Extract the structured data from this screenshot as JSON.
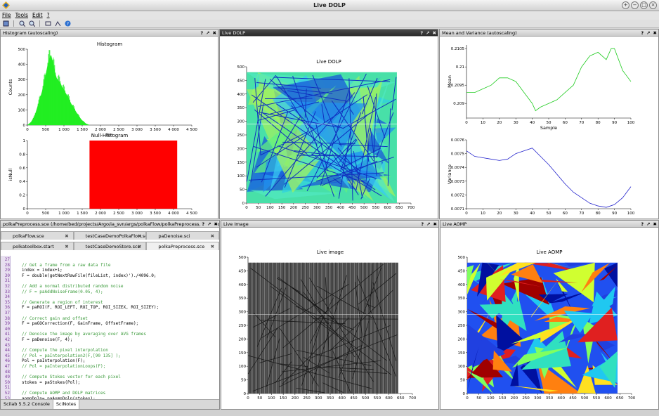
{
  "window": {
    "title": "Live DOLP"
  },
  "menu": [
    {
      "label": "File"
    },
    {
      "label": "Tools"
    },
    {
      "label": "Edit"
    },
    {
      "label": "?"
    }
  ],
  "toolbar_icons": [
    "new-window-icon",
    "zoom-in-icon",
    "zoom-out-icon",
    "rotate-icon",
    "datatip-icon",
    "help-icon"
  ],
  "panels": {
    "histogram": {
      "header": "Histogram (autoscaling)"
    },
    "dolp": {
      "header": "Live DOLP"
    },
    "meanvar": {
      "header": "Mean and Variance (autoscaling)"
    },
    "scinotes": {
      "header": "polkaPreprocess.sce (/home/bed/projects/Argo/ia_svn/args/polkaFlow/polkaPreprocess.sce) - SciNotes"
    },
    "image": {
      "header": "Live Image"
    },
    "aomp": {
      "header": "Live AOMP"
    }
  },
  "panel_buttons": [
    "?",
    "↗",
    "✖"
  ],
  "chart_data": [
    {
      "type": "bar",
      "title": "Histogram",
      "xlabel": "Bin",
      "ylabel": "Counts",
      "xlim": [
        0,
        4500
      ],
      "ylim": [
        0,
        500
      ],
      "xticks": [
        "0",
        "500",
        "1 000",
        "1 500",
        "2 000",
        "2 500",
        "3 000",
        "3 500",
        "4 000",
        "4 500"
      ],
      "yticks": [
        "0",
        "100",
        "200",
        "300",
        "400",
        "500"
      ],
      "x": [
        0,
        100,
        200,
        300,
        400,
        500,
        550,
        600,
        650,
        700,
        750,
        800,
        850,
        900,
        950,
        1000,
        1100,
        1200,
        1300,
        1400,
        1500,
        1600,
        1700
      ],
      "values": [
        0,
        20,
        60,
        140,
        220,
        330,
        390,
        440,
        460,
        410,
        350,
        310,
        290,
        280,
        250,
        230,
        190,
        140,
        100,
        60,
        30,
        10,
        0
      ],
      "color": "#22ee22"
    },
    {
      "type": "bar",
      "title": "Null-Histogram",
      "xlabel": "",
      "ylabel": "isNull",
      "xlim": [
        0,
        4500
      ],
      "ylim": [
        0,
        1
      ],
      "xticks": [
        "0",
        "500",
        "1 000",
        "1 500",
        "2 000",
        "2 500",
        "3 000",
        "3 500",
        "4 000",
        "4 500"
      ],
      "yticks": [
        "0",
        "0.2",
        "0.4",
        "0.6",
        "0.8",
        "1"
      ],
      "bar": {
        "x0": 1700,
        "x1": 4100,
        "value": 1
      },
      "color": "#ff0000"
    },
    {
      "type": "heatmap",
      "title": "Live DOLP",
      "xlim": [
        0,
        700
      ],
      "ylim": [
        0,
        500
      ],
      "xticks": [
        "0",
        "50",
        "100",
        "150",
        "200",
        "250",
        "300",
        "350",
        "400",
        "450",
        "500",
        "550",
        "600",
        "650",
        "700"
      ],
      "yticks": [
        "0",
        "50",
        "100",
        "150",
        "200",
        "250",
        "300",
        "350",
        "400",
        "450",
        "500"
      ]
    },
    {
      "type": "line",
      "xlabel": "Sample",
      "ylabel": "Mean",
      "xlim": [
        0,
        100
      ],
      "ylim": [
        0.2086,
        0.2106
      ],
      "xticks": [
        "0",
        "10",
        "20",
        "30",
        "40",
        "50",
        "60",
        "70",
        "80",
        "90",
        "100"
      ],
      "yticks": [
        "0.209",
        "0.2095",
        "0.21",
        "0.2105"
      ],
      "series": [
        {
          "x": [
            0,
            5,
            10,
            15,
            20,
            25,
            30,
            35,
            40,
            42,
            45,
            50,
            55,
            60,
            65,
            70,
            75,
            80,
            85,
            88,
            90,
            95,
            100
          ],
          "values": [
            0.2093,
            0.2093,
            0.2094,
            0.2095,
            0.2097,
            0.2097,
            0.2096,
            0.2093,
            0.209,
            0.2088,
            0.2089,
            0.209,
            0.2091,
            0.2093,
            0.2095,
            0.21,
            0.2103,
            0.2104,
            0.2102,
            0.2105,
            0.2105,
            0.2099,
            0.2096
          ]
        }
      ],
      "color": "#22cc22"
    },
    {
      "type": "line",
      "xlabel": "",
      "ylabel": "Variance",
      "xlim": [
        0,
        100
      ],
      "ylim": [
        0.0071,
        0.0076
      ],
      "xticks": [
        "0",
        "10",
        "20",
        "30",
        "40",
        "50",
        "60",
        "70",
        "80",
        "90",
        "100"
      ],
      "yticks": [
        "0.0071",
        "0.0072",
        "0.0073",
        "0.0074",
        "0.0075",
        "0.0076"
      ],
      "series": [
        {
          "x": [
            0,
            5,
            10,
            15,
            20,
            25,
            30,
            35,
            40,
            45,
            50,
            55,
            60,
            65,
            70,
            75,
            80,
            85,
            90,
            95,
            100
          ],
          "values": [
            0.00752,
            0.00748,
            0.00747,
            0.00746,
            0.00745,
            0.00746,
            0.0075,
            0.00752,
            0.00754,
            0.00748,
            0.00742,
            0.00735,
            0.00728,
            0.00722,
            0.00718,
            0.00714,
            0.00712,
            0.00711,
            0.00713,
            0.00718,
            0.00726
          ]
        }
      ],
      "color": "#2222cc"
    },
    {
      "type": "heatmap",
      "title": "Live image",
      "xlim": [
        0,
        700
      ],
      "ylim": [
        0,
        500
      ],
      "xticks": [
        "0",
        "50",
        "100",
        "150",
        "200",
        "250",
        "300",
        "350",
        "400",
        "450",
        "500",
        "550",
        "600",
        "650",
        "700"
      ],
      "yticks": [
        "0",
        "50",
        "100",
        "150",
        "200",
        "250",
        "300",
        "350",
        "400",
        "450",
        "500"
      ]
    },
    {
      "type": "heatmap",
      "title": "Live AOMP",
      "xlim": [
        0,
        700
      ],
      "ylim": [
        0,
        500
      ],
      "xticks": [
        "0",
        "50",
        "100",
        "150",
        "200",
        "250",
        "300",
        "350",
        "400",
        "450",
        "500",
        "550",
        "600",
        "650",
        "700"
      ],
      "yticks": [
        "0",
        "50",
        "100",
        "150",
        "200",
        "250",
        "300",
        "350",
        "400",
        "450",
        "500"
      ]
    }
  ],
  "editor": {
    "tabs_row1": [
      {
        "label": "polkaFlow.sce"
      },
      {
        "label": "testCaseDemoPolkaFlow.sce"
      },
      {
        "label": "paDenoise.sci"
      }
    ],
    "tabs_row2": [
      {
        "label": "polkatoolbox.start"
      },
      {
        "label": "testCaseDemoStore.sce"
      },
      {
        "label": "polkaPreprocess.sce"
      }
    ],
    "lines": [
      {
        "n": "27",
        "t": ""
      },
      {
        "n": "28",
        "t": "// Get a frame from a raw data file",
        "c": true
      },
      {
        "n": "29",
        "t": "index = index+1;"
      },
      {
        "n": "30",
        "t": "F = double(getNextRawFile(fileList, index)')./4096.0;"
      },
      {
        "n": "31",
        "t": ""
      },
      {
        "n": "32",
        "t": "// Add a normal distributed random noise",
        "c": true
      },
      {
        "n": "33",
        "t": "// F = paAddNoiseFrame(0.05, 4);",
        "c": true
      },
      {
        "n": "34",
        "t": ""
      },
      {
        "n": "35",
        "t": "// Generate a region of interest",
        "c": true
      },
      {
        "n": "36",
        "t": "F = paROI(F, ROI_LEFT, ROI_TOP, ROI_SIZEX, ROI_SIZEY);"
      },
      {
        "n": "37",
        "t": ""
      },
      {
        "n": "38",
        "t": "// Correct gain and offset",
        "c": true
      },
      {
        "n": "39",
        "t": "F = paGOCorrection(F, GainFrame, OffsetFrame);"
      },
      {
        "n": "40",
        "t": ""
      },
      {
        "n": "41",
        "t": "// Denoise the image by averaging over AVG frames",
        "c": true
      },
      {
        "n": "42",
        "t": "F = paDenoise(F, 4);"
      },
      {
        "n": "43",
        "t": ""
      },
      {
        "n": "44",
        "t": "// Compute the pixel interpolation",
        "c": true
      },
      {
        "n": "45",
        "t": "// Pol = paInterpolation2(F,[90 135] );",
        "c": true
      },
      {
        "n": "46",
        "t": "Pol = paInterpolation(F);"
      },
      {
        "n": "47",
        "t": "// Pol = paInterpolationLoops(F);",
        "c": true
      },
      {
        "n": "48",
        "t": ""
      },
      {
        "n": "49",
        "t": "// Compute Stokes vector for each pixel",
        "c": true
      },
      {
        "n": "50",
        "t": "stokes = paStokes(Pol);"
      },
      {
        "n": "51",
        "t": ""
      },
      {
        "n": "52",
        "t": "// Compute AOMP and DOLP matrices",
        "c": true
      },
      {
        "n": "53",
        "t": "aompDolp= paAompDolp(stokes);"
      }
    ],
    "bottom_tabs": [
      {
        "label": "Scilab 5.5.2 Console"
      },
      {
        "label": "SciNotes"
      }
    ]
  }
}
